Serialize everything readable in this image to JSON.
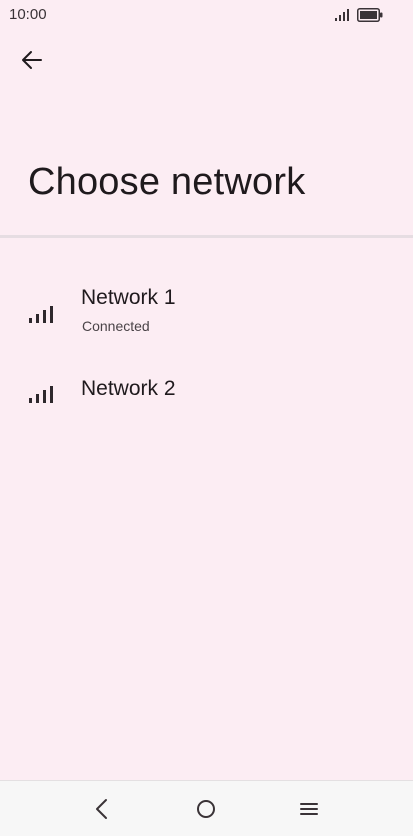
{
  "status_bar": {
    "time": "10:00",
    "icons": [
      "signal-icon",
      "battery-icon"
    ]
  },
  "header": {
    "title": "Choose network",
    "back_icon": "arrow-left-icon"
  },
  "networks": [
    {
      "name": "Network 1",
      "status": "Connected",
      "icon": "signal-icon"
    },
    {
      "name": "Network 2",
      "status": "",
      "icon": "signal-icon"
    }
  ],
  "nav_bar": {
    "buttons": [
      "back-icon",
      "home-icon",
      "menu-icon"
    ]
  },
  "colors": {
    "background": "#fcedf3",
    "text": "#1f1a1d",
    "nav_background": "#f7f7f7"
  }
}
